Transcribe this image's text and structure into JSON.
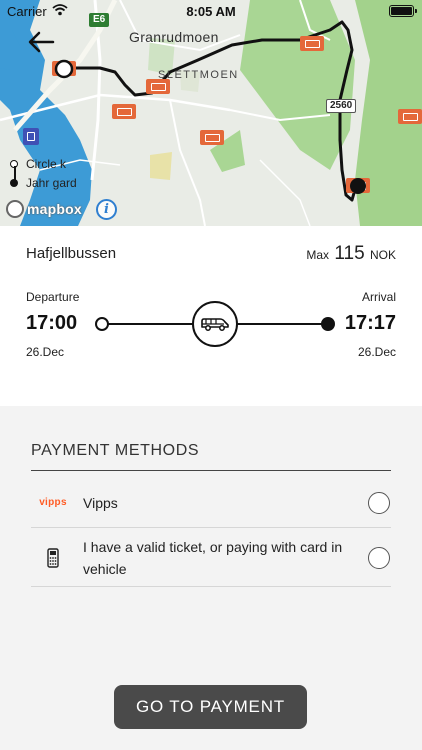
{
  "status_bar": {
    "carrier": "Carrier",
    "time": "8:05 AM",
    "icons": [
      "wifi-icon",
      "battery-icon"
    ]
  },
  "map": {
    "places": {
      "granrudmoen": "Granrudmoen",
      "slettmoen": "SLETTMOEN"
    },
    "road_shields": {
      "e6": "E6",
      "r2560": "2560"
    },
    "legend": {
      "start": "Circle k",
      "end": "Jahr gard"
    },
    "attribution": "mapbox",
    "info_symbol": "i",
    "colors": {
      "water": "#3d9bd6",
      "park": "#9fd08a",
      "bus_stop": "#e4683a",
      "route": "#111111"
    }
  },
  "trip": {
    "operator": "Hafjellbussen",
    "price": {
      "prefix": "Max",
      "amount": "115",
      "currency": "NOK"
    },
    "departure": {
      "label": "Departure",
      "time": "17:00",
      "date": "26.Dec"
    },
    "arrival": {
      "label": "Arrival",
      "time": "17:17",
      "date": "26.Dec"
    },
    "vehicle_icon": "van-icon"
  },
  "payment": {
    "title": "PAYMENT METHODS",
    "methods": [
      {
        "logo": "vipps",
        "label": "Vipps",
        "selected": false
      },
      {
        "icon": "card-terminal-icon",
        "label": "I have a valid ticket, or paying with card in vehicle",
        "selected": false
      }
    ],
    "button_label": "GO TO PAYMENT"
  }
}
